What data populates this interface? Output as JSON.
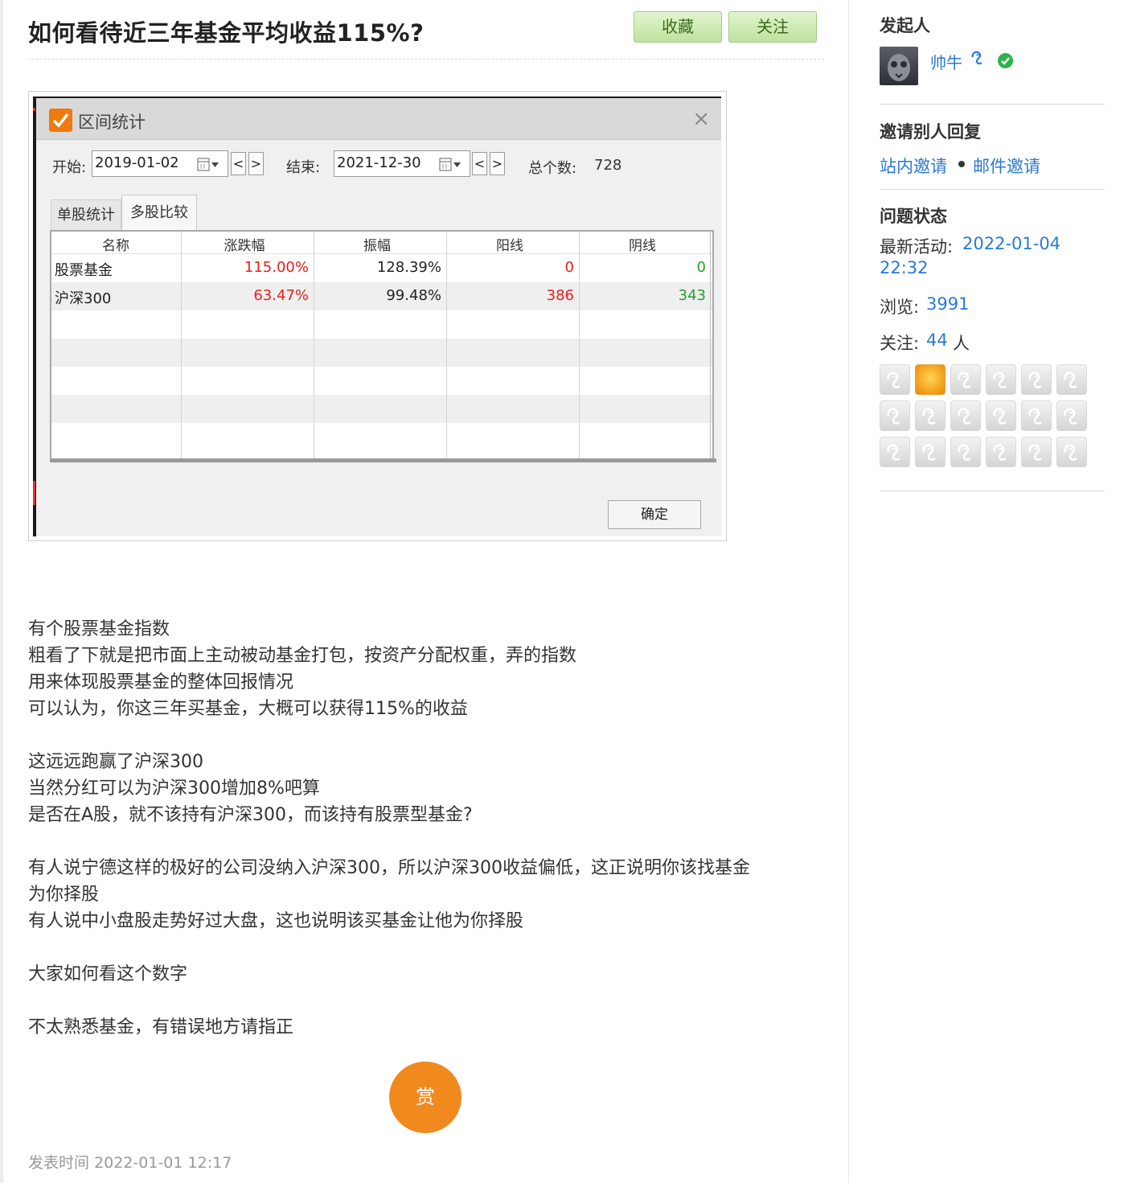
{
  "question": {
    "title": "如何看待近三年基金平均收益115%?",
    "buttons": {
      "favorite": "收藏",
      "follow": "关注"
    },
    "published_label": "发表时间",
    "published_time": "2022-01-01 12:17",
    "reward_label": "赏",
    "body_lines": [
      "有个股票基金指数",
      "粗看了下就是把市面上主动被动基金打包，按资产分配权重，弄的指数",
      "用来体现股票基金的整体回报情况",
      "可以认为，你这三年买基金，大概可以获得115%的收益",
      "",
      "这远远跑赢了沪深300",
      "当然分红可以为沪深300增加8%吧算",
      "是否在A股，就不该持有沪深300，而该持有股票型基金?",
      "",
      "有人说宁德这样的极好的公司没纳入沪深300，所以沪深300收益偏低，这正说明你该找基金",
      "为你择股",
      "有人说中小盘股走势好过大盘，这也说明该买基金让他为你择股",
      "",
      "大家如何看这个数字",
      "",
      "不太熟悉基金，有错误地方请指正"
    ]
  },
  "dialog": {
    "title": "区间统计",
    "close": "×",
    "start_label": "开始:",
    "start_date": "2019-01-02",
    "end_label": "结束:",
    "end_date": "2021-12-30",
    "prev": "<",
    "next": ">",
    "count_label": "总个数:",
    "count": "728",
    "tabs": [
      "单股统计",
      "多股比较"
    ],
    "columns": [
      "名称",
      "涨跌幅",
      "振幅",
      "阳线",
      "阴线"
    ],
    "rows": [
      {
        "name": "股票基金",
        "change": "115.00%",
        "amplitude": "128.39%",
        "up": "0",
        "down": "0"
      },
      {
        "name": "沪深300",
        "change": "63.47%",
        "amplitude": "99.48%",
        "up": "386",
        "down": "343"
      }
    ],
    "ok": "确定",
    "colors": {
      "up": "#e8201a",
      "down": "#26a12a",
      "accent": "#f07a0c"
    }
  },
  "sidebar": {
    "initiator_heading": "发起人",
    "author": "帅牛",
    "invite_heading": "邀请别人回复",
    "invite_site": "站内邀请",
    "invite_email": "邮件邀请",
    "status_heading": "问题状态",
    "latest_label": "最新活动:",
    "latest_date": "2022-01-04",
    "latest_time": "22:32",
    "views_label": "浏览:",
    "views": "3991",
    "follow_label": "关注:",
    "follow_count": "44",
    "follow_unit": "人",
    "follower_avatars": [
      "default-avatar-icon",
      "orange-avatar",
      "default-avatar-icon",
      "default-avatar-icon",
      "default-avatar-icon",
      "default-avatar-icon",
      "default-avatar-icon",
      "default-avatar-icon",
      "default-avatar-icon",
      "default-avatar-icon",
      "default-avatar-icon",
      "default-avatar-icon",
      "default-avatar-icon",
      "default-avatar-icon",
      "default-avatar-icon",
      "default-avatar-icon",
      "default-avatar-icon",
      "default-avatar-icon"
    ]
  }
}
